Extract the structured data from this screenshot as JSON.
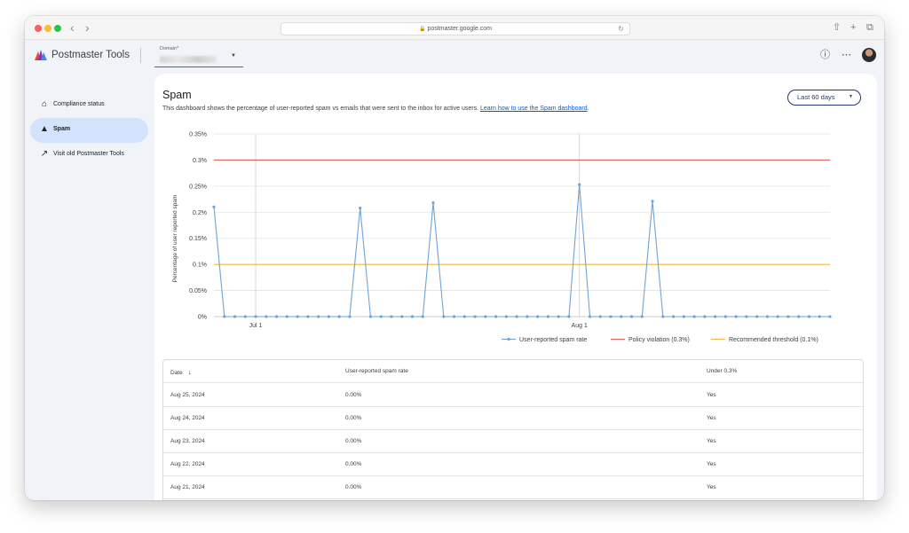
{
  "browser": {
    "url": "postmaster.google.com"
  },
  "header": {
    "app_title": "Postmaster Tools",
    "domain_label": "Domain*"
  },
  "sidebar": {
    "items": [
      {
        "label": "Compliance status",
        "icon": "home-icon",
        "active": false
      },
      {
        "label": "Spam",
        "icon": "warning-icon",
        "active": true
      },
      {
        "label": "Visit old Postmaster Tools",
        "icon": "open-in-new-icon",
        "active": false
      }
    ]
  },
  "main": {
    "title": "Spam",
    "description": "This dashboard shows the percentage of user-reported spam vs emails that were sent to the inbox for active users.",
    "learn_link": "Learn how to use the Spam dashboard",
    "learn_link_suffix": ".",
    "range_button": "Last 60 days"
  },
  "chart_data": {
    "type": "line",
    "title": "",
    "ylabel": "Percentage of user reported spam",
    "xlabel": "",
    "ylim": [
      0,
      0.35
    ],
    "y_ticks": [
      "0%",
      "0.05%",
      "0.1%",
      "0.15%",
      "0.2%",
      "0.25%",
      "0.3%",
      "0.35%"
    ],
    "x_ticks": [
      {
        "label": "Jul 1",
        "index": 4
      },
      {
        "label": "Aug 1",
        "index": 35
      }
    ],
    "grid": true,
    "legend_position": "bottom-right",
    "series": [
      {
        "name": "User-reported spam rate",
        "color": "#6fa3d8",
        "values": [
          0.21,
          0,
          0,
          0,
          0,
          0,
          0,
          0,
          0,
          0,
          0,
          0,
          0,
          0,
          0.208,
          0,
          0,
          0,
          0,
          0,
          0,
          0.218,
          0,
          0,
          0,
          0,
          0,
          0,
          0,
          0,
          0,
          0,
          0,
          0,
          0,
          0.253,
          0,
          0,
          0,
          0,
          0,
          0,
          0.221,
          0,
          0,
          0,
          0,
          0,
          0,
          0,
          0,
          0,
          0,
          0,
          0,
          0,
          0,
          0,
          0,
          0
        ]
      }
    ],
    "reference_lines": [
      {
        "name": "Policy violation (0.3%)",
        "value": 0.3,
        "color": "#e06666"
      },
      {
        "name": "Recommended threshold (0.1%)",
        "value": 0.1,
        "color": "#f1b843"
      }
    ]
  },
  "table": {
    "headers": [
      "Date",
      "User-reported spam rate",
      "Under 0.3%"
    ],
    "rows": [
      [
        "Aug 25, 2024",
        "0.00%",
        "Yes"
      ],
      [
        "Aug 24, 2024",
        "0.00%",
        "Yes"
      ],
      [
        "Aug 23, 2024",
        "0.00%",
        "Yes"
      ],
      [
        "Aug 22, 2024",
        "0.00%",
        "Yes"
      ],
      [
        "Aug 21, 2024",
        "0.00%",
        "Yes"
      ]
    ]
  }
}
